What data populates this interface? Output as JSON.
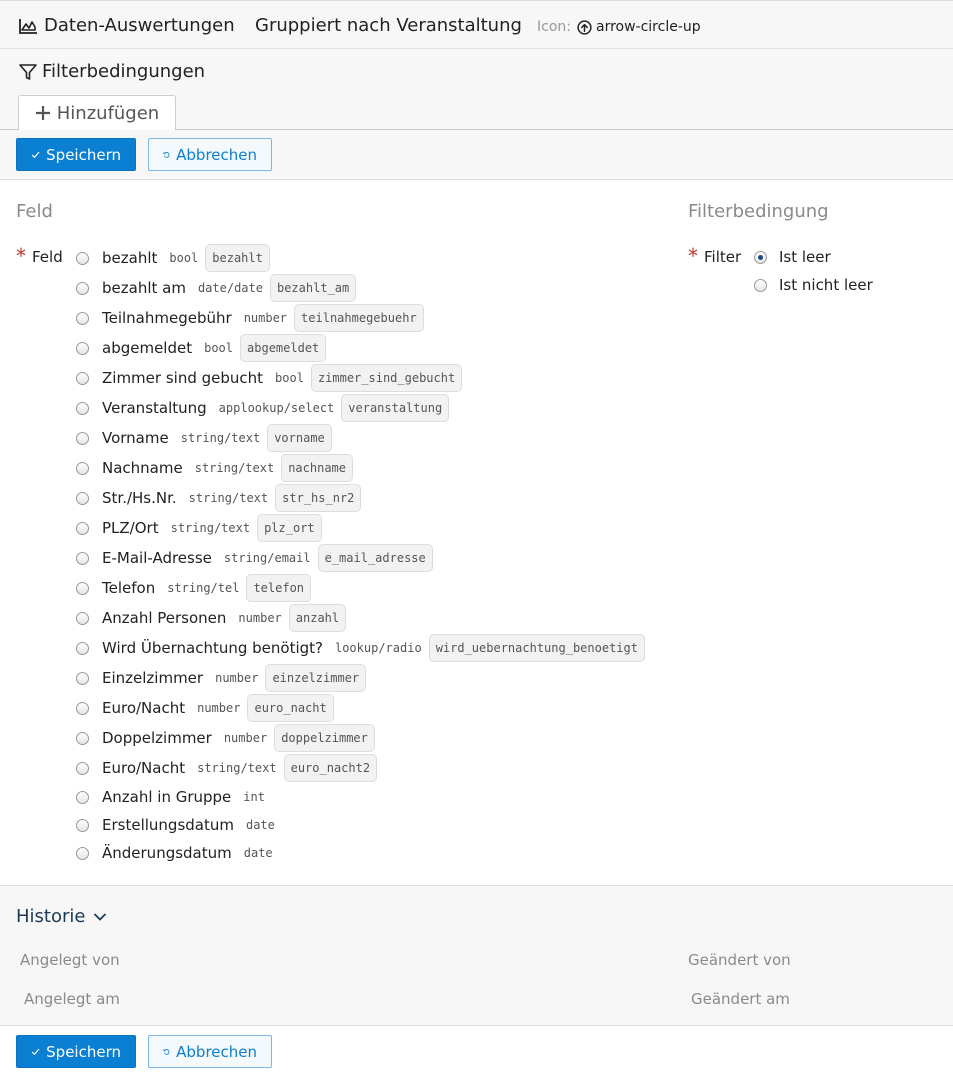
{
  "header": {
    "title": "Daten-Auswertungen",
    "subtitle": "Gruppiert nach Veranstaltung",
    "icon_label": "Icon:",
    "icon_name": "arrow-circle-up"
  },
  "filter_panel": {
    "title": "Filterbedingungen",
    "add_tab": "Hinzufügen"
  },
  "actions": {
    "save": "Speichern",
    "cancel": "Abbrechen"
  },
  "form": {
    "field_section": "Feld",
    "field_label": "Feld",
    "condition_section": "Filterbedingung",
    "filter_label": "Filter",
    "fields": [
      {
        "name": "bezahlt",
        "type": "bool",
        "key": "bezahlt"
      },
      {
        "name": "bezahlt am",
        "type": "date/date",
        "key": "bezahlt_am"
      },
      {
        "name": "Teilnahmegebühr",
        "type": "number",
        "key": "teilnahmegebuehr"
      },
      {
        "name": "abgemeldet",
        "type": "bool",
        "key": "abgemeldet"
      },
      {
        "name": "Zimmer sind gebucht",
        "type": "bool",
        "key": "zimmer_sind_gebucht"
      },
      {
        "name": "Veranstaltung",
        "type": "applookup/select",
        "key": "veranstaltung"
      },
      {
        "name": "Vorname",
        "type": "string/text",
        "key": "vorname"
      },
      {
        "name": "Nachname",
        "type": "string/text",
        "key": "nachname"
      },
      {
        "name": "Str./Hs.Nr.",
        "type": "string/text",
        "key": "str_hs_nr2"
      },
      {
        "name": "PLZ/Ort",
        "type": "string/text",
        "key": "plz_ort"
      },
      {
        "name": "E-Mail-Adresse",
        "type": "string/email",
        "key": "e_mail_adresse"
      },
      {
        "name": "Telefon",
        "type": "string/tel",
        "key": "telefon"
      },
      {
        "name": "Anzahl Personen",
        "type": "number",
        "key": "anzahl"
      },
      {
        "name": "Wird Übernachtung benötigt?",
        "type": "lookup/radio",
        "key": "wird_uebernachtung_benoetigt"
      },
      {
        "name": "Einzelzimmer",
        "type": "number",
        "key": "einzelzimmer"
      },
      {
        "name": "Euro/Nacht",
        "type": "number",
        "key": "euro_nacht"
      },
      {
        "name": "Doppelzimmer",
        "type": "number",
        "key": "doppelzimmer"
      },
      {
        "name": "Euro/Nacht",
        "type": "string/text",
        "key": "euro_nacht2"
      },
      {
        "name": "Anzahl in Gruppe",
        "type": "int",
        "key": ""
      },
      {
        "name": "Erstellungsdatum",
        "type": "date",
        "key": ""
      },
      {
        "name": "Änderungsdatum",
        "type": "date",
        "key": ""
      }
    ],
    "filter_options": [
      {
        "label": "Ist leer",
        "checked": true
      },
      {
        "label": "Ist nicht leer",
        "checked": false
      }
    ]
  },
  "history": {
    "title": "Historie",
    "created_by": "Angelegt von",
    "created_at": "Angelegt am",
    "modified_by": "Geändert von",
    "modified_at": "Geändert am"
  }
}
